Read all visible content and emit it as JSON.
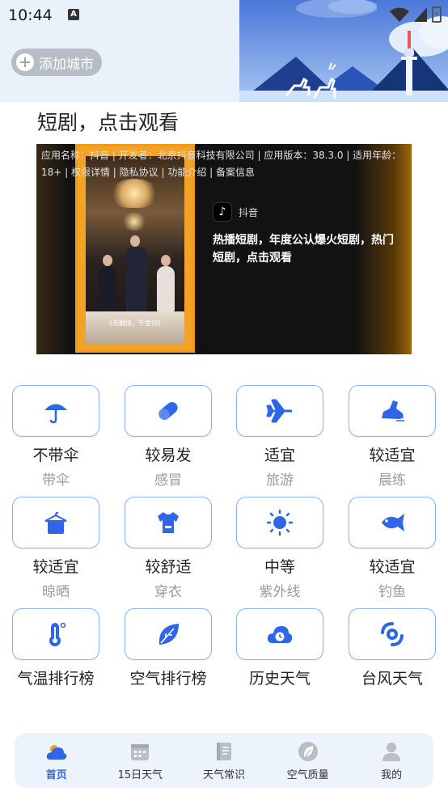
{
  "status_bar": {
    "time": "10:44",
    "notif_icon": "A"
  },
  "header": {
    "add_city_label": "添加城市"
  },
  "ad": {
    "section_title": "短剧，点击观看",
    "meta_text": "应用名称：抖音 | 开发者：北京抖音科技有限公司 | 应用版本：38.3.0 | 适用年龄：18+ | 权限详情 | 隐私协议 | 功能介绍 | 备案信息",
    "app_name": "抖音",
    "headline": "热播短剧，年度公认爆火短剧，热门短剧，点击观看",
    "poster_caption": "《花翻惊，千金归》"
  },
  "indices": [
    {
      "value": "不带伞",
      "category": "带伞",
      "icon": "umbrella-icon"
    },
    {
      "value": "较易发",
      "category": "感冒",
      "icon": "pill-icon"
    },
    {
      "value": "适宜",
      "category": "旅游",
      "icon": "airplane-icon"
    },
    {
      "value": "较适宜",
      "category": "晨练",
      "icon": "running-shoe-icon"
    },
    {
      "value": "较适宜",
      "category": "晾晒",
      "icon": "hanger-icon"
    },
    {
      "value": "较舒适",
      "category": "穿衣",
      "icon": "tshirt-icon"
    },
    {
      "value": "中等",
      "category": "紫外线",
      "icon": "sun-icon"
    },
    {
      "value": "较适宜",
      "category": "钓鱼",
      "icon": "fish-icon"
    }
  ],
  "tools": [
    {
      "label": "气温排行榜",
      "icon": "thermometer-icon"
    },
    {
      "label": "空气排行榜",
      "icon": "leaf-icon"
    },
    {
      "label": "历史天气",
      "icon": "cloud-clock-icon"
    },
    {
      "label": "台风天气",
      "icon": "typhoon-icon"
    }
  ],
  "nav": [
    {
      "label": "首页",
      "icon": "home-weather-icon",
      "active": true
    },
    {
      "label": "15日天气",
      "icon": "calendar-icon",
      "active": false
    },
    {
      "label": "天气常识",
      "icon": "book-icon",
      "active": false
    },
    {
      "label": "空气质量",
      "icon": "air-quality-icon",
      "active": false
    },
    {
      "label": "我的",
      "icon": "profile-icon",
      "active": false
    }
  ],
  "colors": {
    "accent": "#2e66e6",
    "tile_border": "#8fb0ee",
    "nav_bg": "#edf3fc"
  }
}
